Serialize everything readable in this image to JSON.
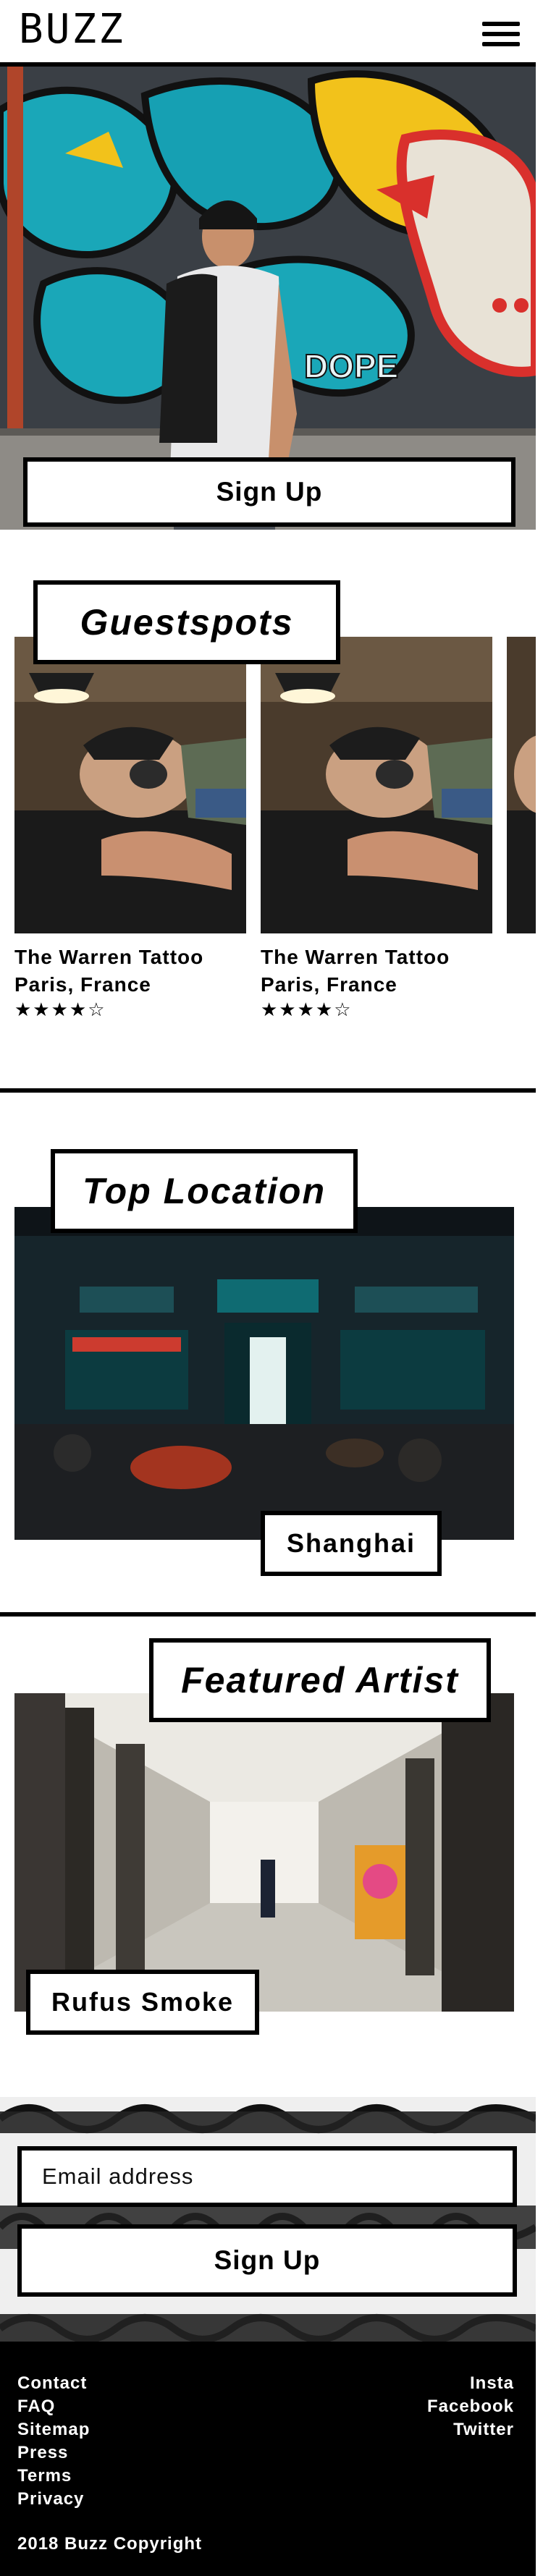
{
  "header": {
    "logo": "BUZZ",
    "menu_icon": "hamburger-menu-icon"
  },
  "hero": {
    "cta_label": "Sign Up",
    "graffiti_text": "DOPE"
  },
  "guestspots": {
    "title": "Guestspots",
    "cards": [
      {
        "name": "The Warren Tattoo",
        "location": "Paris, France",
        "stars": "★★★★☆",
        "rating": 4
      },
      {
        "name": "The Warren Tattoo",
        "location": "Paris, France",
        "stars": "★★★★☆",
        "rating": 4
      }
    ]
  },
  "top_location": {
    "title": "Top Location",
    "city": "Shanghai"
  },
  "featured_artist": {
    "title": "Featured Artist",
    "name": "Rufus Smoke"
  },
  "signup": {
    "email_placeholder": "Email address",
    "button_label": "Sign Up"
  },
  "footer": {
    "left_links": [
      "Contact",
      "FAQ",
      "Sitemap",
      "Press",
      "Terms",
      "Privacy"
    ],
    "right_links": [
      "Insta",
      "Facebook",
      "Twitter"
    ],
    "copyright": "2018 Buzz Copyright"
  },
  "colors": {
    "ink": "#000000",
    "paper": "#ffffff",
    "teal": "#1aa7b8",
    "graffiti_yellow": "#f2c21b",
    "graffiti_red": "#d9302c"
  }
}
